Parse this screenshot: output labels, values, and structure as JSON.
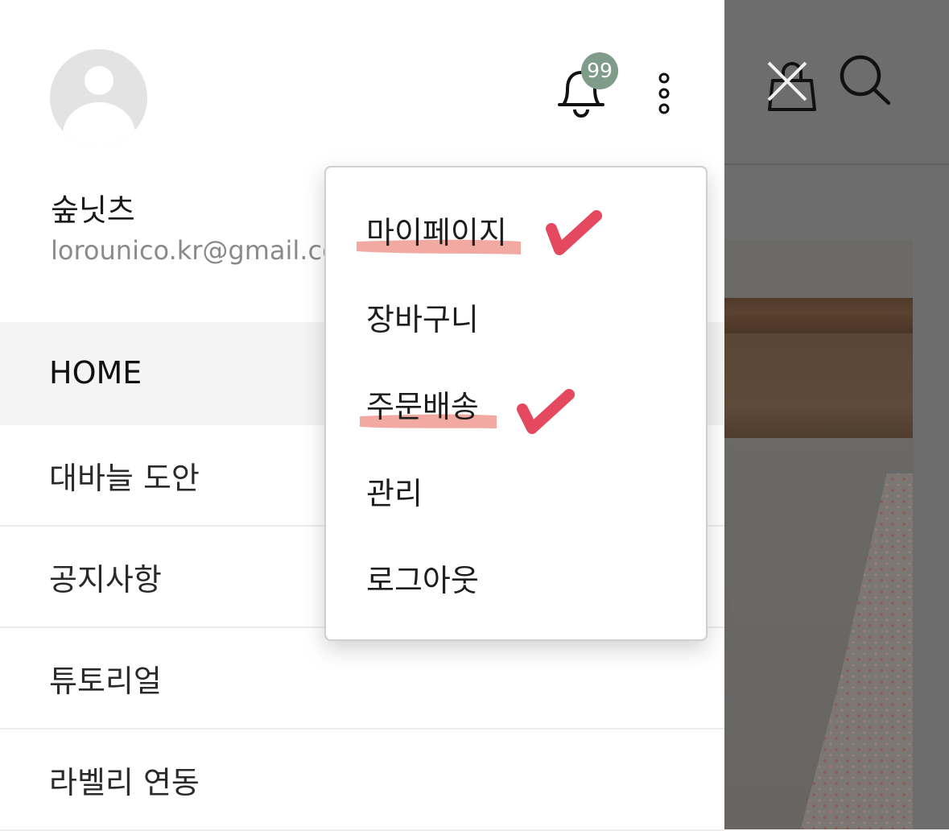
{
  "profile": {
    "name": "숲닛츠",
    "email": "lorounico.kr@gmail.com"
  },
  "header": {
    "notification_count": "99",
    "icons": {
      "notifications": "bell-icon",
      "more": "more-vertical-icon",
      "cart": "shopping-bag-icon",
      "search": "search-icon"
    }
  },
  "nav": {
    "items": [
      {
        "label": "HOME",
        "active": true
      },
      {
        "label": "대바늘 도안",
        "active": false
      },
      {
        "label": "공지사항",
        "active": false
      },
      {
        "label": "튜토리얼",
        "active": false
      },
      {
        "label": "라벨리 연동",
        "active": false
      }
    ]
  },
  "menu": {
    "items": [
      {
        "label": "마이페이지",
        "annotated": true
      },
      {
        "label": "장바구니",
        "annotated": false
      },
      {
        "label": "주문배송",
        "annotated": true
      },
      {
        "label": "관리",
        "annotated": false
      },
      {
        "label": "로그아웃",
        "annotated": false
      }
    ]
  },
  "colors": {
    "badge": "#7f9c8a",
    "annotation_check": "#e4495f",
    "annotation_highlight": "#f09a92",
    "overlay": "#6d6d6d",
    "active_row": "#f4f4f4"
  }
}
